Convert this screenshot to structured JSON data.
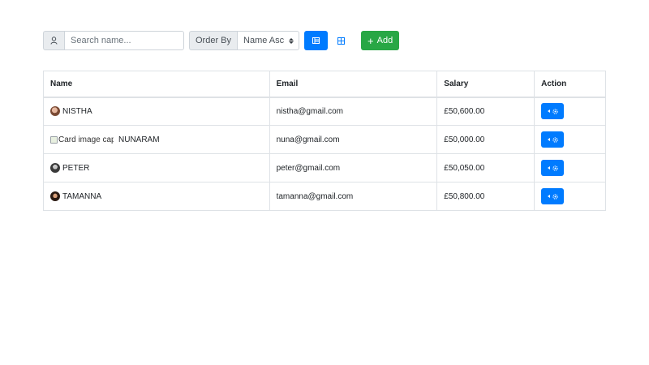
{
  "toolbar": {
    "search": {
      "placeholder": "Search name...",
      "value": "",
      "icon": "user-icon"
    },
    "order": {
      "label": "Order By",
      "selected": "Name Asc"
    },
    "view_list_icon": "list-view-icon",
    "view_grid_icon": "grid-view-icon",
    "add": {
      "label": "Add",
      "icon": "plus-icon"
    }
  },
  "table": {
    "headers": [
      "Name",
      "Email",
      "Salary",
      "Action"
    ],
    "rows": [
      {
        "name": "NISTHA",
        "email": "nistha@gmail.com",
        "salary": "£50,600.00",
        "avatar": "avatar"
      },
      {
        "name": "NUNARAM",
        "email": "nuna@gmail.com",
        "salary": "£50,000.00",
        "avatar": "broken-image",
        "alt": "Card image cap"
      },
      {
        "name": "PETER",
        "email": "peter@gmail.com",
        "salary": "£50,050.00",
        "avatar": "avatar"
      },
      {
        "name": "TAMANNA",
        "email": "tamanna@gmail.com",
        "salary": "£50,800.00",
        "avatar": "avatar"
      }
    ],
    "action_icon": "settings-icon"
  },
  "colors": {
    "primary": "#007bff",
    "success": "#28a745",
    "border": "#dee2e6",
    "addon_bg": "#e9ecef"
  }
}
